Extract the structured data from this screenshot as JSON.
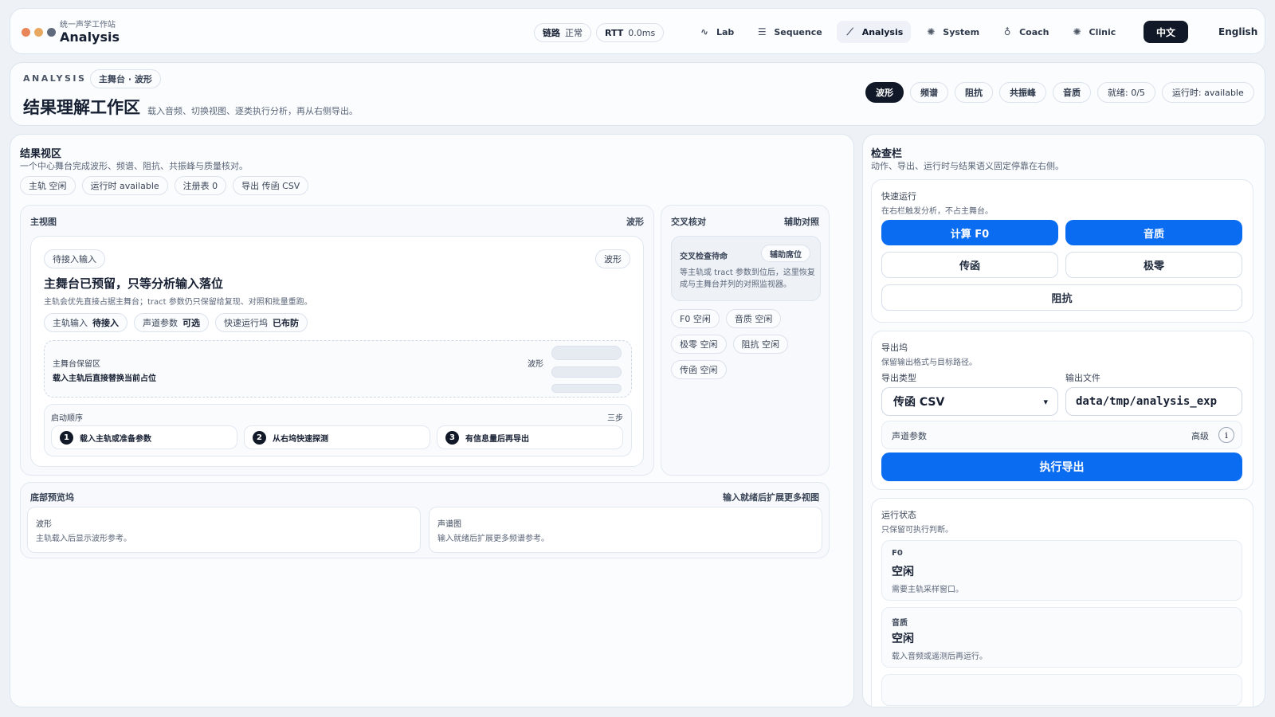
{
  "app": {
    "subtitle": "统一声学工作站",
    "title": "Analysis"
  },
  "topbar": {
    "link_label": "链路",
    "link_status": "正常",
    "rtt_label": "RTT",
    "rtt_value": "0.0ms",
    "nav": [
      {
        "label": "Lab",
        "icon": "waveform-icon"
      },
      {
        "label": "Sequence",
        "icon": "sliders-icon"
      },
      {
        "label": "Analysis",
        "icon": "chart-line-icon"
      },
      {
        "label": "System",
        "icon": "gear-icon"
      },
      {
        "label": "Coach",
        "icon": "microphone-icon"
      },
      {
        "label": "Clinic",
        "icon": "settings-icon"
      }
    ],
    "lang_zh": "中文",
    "lang_en": "English"
  },
  "header": {
    "eyebrow": "ANALYSIS",
    "stage_tag": "主舞台 · 波形",
    "title": "结果理解工作区",
    "description": "载入音频、切换视图、逐类执行分析，再从右侧导出。",
    "view_tabs": [
      "波形",
      "频谱",
      "阻抗",
      "共振峰",
      "音质"
    ],
    "ready": "就绪: 0/5",
    "runtime": "运行时: available"
  },
  "results": {
    "title": "结果视区",
    "subtitle": "一个中心舞台完成波形、频谱、阻抗、共振峰与质量核对。",
    "pills": [
      "主轨 空闲",
      "运行时 available",
      "注册表 0",
      "导出 传函 CSV"
    ]
  },
  "main_view": {
    "label": "主视图",
    "mode": "波形",
    "status_pill": "待接入输入",
    "mode_pill": "波形",
    "headline": "主舞台已预留，只等分析输入落位",
    "note": "主轨会优先直接占据主舞台；tract 参数仍只保留给复现、对照和批量重跑。",
    "chips": [
      {
        "label": "主轨输入",
        "value": "待接入"
      },
      {
        "label": "声道参数",
        "value": "可选"
      },
      {
        "label": "快速运行坞",
        "value": "已布防"
      }
    ],
    "reserve_label": "主舞台保留区",
    "reserve_text": "载入主轨后直接替换当前占位",
    "reserve_mode": "波形",
    "steps_label": "启动顺序",
    "steps_count": "三步",
    "steps": [
      {
        "num": "1",
        "text": "载入主轨或准备参数"
      },
      {
        "num": "2",
        "text": "从右坞快速探测"
      },
      {
        "num": "3",
        "text": "有信息量后再导出"
      }
    ]
  },
  "cross": {
    "label": "交叉核对",
    "aux": "辅助对照",
    "pending_title": "交叉检查待命",
    "pending_tag": "辅助席位",
    "pending_text": "等主轨或 tract 参数到位后，这里恢复成与主舞台并列的对照监视器。",
    "chips": [
      "F0 空闲",
      "音质 空闲",
      "极零 空闲",
      "阻抗 空闲",
      "传函 空闲"
    ]
  },
  "bottom": {
    "label": "底部预览坞",
    "hint": "输入就绪后扩展更多视图",
    "cards": [
      {
        "title": "波形",
        "text": "主轨载入后显示波形参考。"
      },
      {
        "title": "声谱图",
        "text": "输入就绪后扩展更多频谱参考。"
      }
    ]
  },
  "inspector": {
    "title": "检查栏",
    "subtitle": "动作、导出、运行时与结果语义固定停靠在右侧。",
    "quick": {
      "title": "快速运行",
      "subtitle": "在右栏触发分析，不占主舞台。",
      "primary": [
        "计算 F0",
        "音质"
      ],
      "outline": [
        "传函",
        "极零"
      ],
      "wide": "阻抗"
    },
    "export": {
      "title": "导出坞",
      "subtitle": "保留输出格式与目标路径。",
      "type_label": "导出类型",
      "file_label": "输出文件",
      "type_value": "传函 CSV",
      "file_value": "data/tmp/analysis_exp",
      "params_label": "声道参数",
      "params_level": "高级",
      "execute": "执行导出"
    },
    "status": {
      "title": "运行状态",
      "subtitle": "只保留可执行判断。",
      "items": [
        {
          "tag": "F0",
          "state": "空闲",
          "note": "需要主轨采样窗口。"
        },
        {
          "tag": "音质",
          "state": "空闲",
          "note": "载入音频或遥测后再运行。"
        }
      ]
    }
  },
  "colors": {
    "accent": "#0a6cf0",
    "dark": "#111827",
    "background": "#eef2f7"
  }
}
